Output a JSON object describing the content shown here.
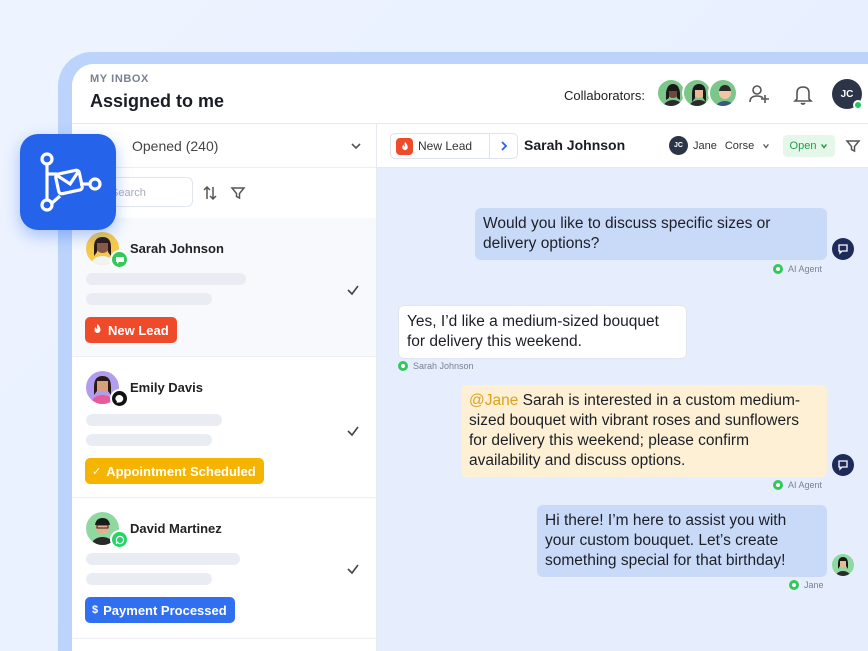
{
  "header": {
    "eyebrow": "MY INBOX",
    "title": "Assigned to me",
    "collaborators_label": "Collaborators:",
    "user_initials": "JC"
  },
  "left": {
    "filter_label": "Opened (240)",
    "search_placeholder": "Search",
    "conversations": [
      {
        "name": "Sarah Johnson",
        "tag": "New Lead",
        "tag_color": "#ef4a2a",
        "channel": "chat-bubble-icon"
      },
      {
        "name": "Emily Davis",
        "tag": "Appointment Scheduled",
        "tag_color": "#f5b400",
        "channel": "messenger-icon"
      },
      {
        "name": "David Martinez",
        "tag": "Payment Processed",
        "tag_color": "#2f6ff0",
        "channel": "whatsapp-icon"
      }
    ]
  },
  "conversation": {
    "lead_label": "New Lead",
    "contact_name": "Sarah Johnson",
    "assignee": "Jane",
    "assignee_last": "Corse",
    "assignee_initials": "JC",
    "status": "Open",
    "messages": [
      {
        "text": "Would you like to discuss specific sizes or delivery options?",
        "author": "AI Agent"
      },
      {
        "text": "Yes, I’d like a medium-sized bouquet for delivery this weekend.",
        "author": "Sarah Johnson"
      },
      {
        "mention": "@Jane",
        "text": " Sarah is interested in a custom medium-sized bouquet with vibrant roses and sunflowers for delivery this weekend; please confirm availability and discuss options.",
        "author": "AI Agent"
      },
      {
        "text": "Hi there! I’m here to assist you with your custom bouquet. Let’s create something special for that birthday!",
        "author": "Jane"
      }
    ]
  },
  "colors": {
    "accent": "#2563eb",
    "ai_bubble": "#c9daf8",
    "note_bubble": "#fdf0d5",
    "online": "#22c55e"
  }
}
